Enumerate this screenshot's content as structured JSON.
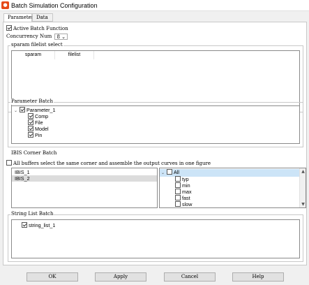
{
  "window": {
    "title": "Batch Simulation Configuration",
    "icon": "app-icon"
  },
  "tabs": [
    {
      "label": "Parameter"
    },
    {
      "label": "Data"
    }
  ],
  "active_batch": {
    "label": "Active Batch Function",
    "checked": true
  },
  "concurrency": {
    "label": "Concurrency Num",
    "value": "8"
  },
  "sparam": {
    "title": "sparam filelist select",
    "columns": [
      "sparam",
      "filelist"
    ]
  },
  "param_batch": {
    "title": "Parameter Batch",
    "root": "Parameter_1",
    "children": [
      "Comp",
      "File",
      "Model",
      "Pin"
    ]
  },
  "ibis": {
    "title": "IBIS Corner Batch",
    "all_buffers_label": "All buffers select the same corner and assemble the output curves in one figure",
    "list": [
      "IBIS_1",
      "IBIS_2"
    ],
    "corner_root": "All",
    "corners": [
      "typ",
      "min",
      "max",
      "fast",
      "slow"
    ]
  },
  "string_list": {
    "title": "String List Batch",
    "items": [
      "string_list_1"
    ]
  },
  "buttons": {
    "ok": "OK",
    "apply": "Apply",
    "cancel": "Cancel",
    "help": "Help"
  }
}
